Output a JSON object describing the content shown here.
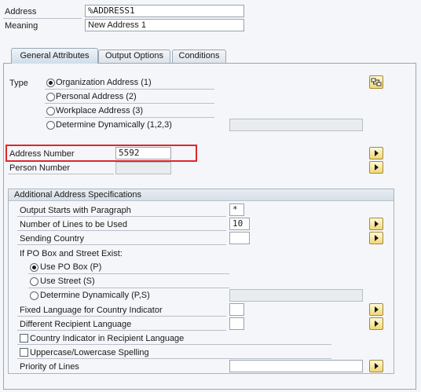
{
  "header": {
    "address_label": "Address",
    "address_value": "%ADDRESS1",
    "meaning_label": "Meaning",
    "meaning_value": "New Address 1"
  },
  "tabs": [
    {
      "label": "General Attributes",
      "active": true
    },
    {
      "label": "Output Options",
      "active": false
    },
    {
      "label": "Conditions",
      "active": false
    }
  ],
  "type_section": {
    "label": "Type",
    "options": [
      {
        "label": "Organization Address (1)",
        "selected": true
      },
      {
        "label": "Personal Address (2)",
        "selected": false
      },
      {
        "label": "Workplace Address (3)",
        "selected": false
      },
      {
        "label": "Determine Dynamically (1,2,3)",
        "selected": false
      }
    ],
    "dynamic_value": "",
    "icon": "address-type-icon"
  },
  "address_number": {
    "label": "Address Number",
    "value": "5592",
    "highlight_color": "#e0262b"
  },
  "person_number": {
    "label": "Person Number",
    "value": ""
  },
  "additional": {
    "title": "Additional Address Specifications",
    "output_starts_label": "Output Starts with Paragraph",
    "output_starts_value": "*",
    "lines_label": "Number of Lines to be Used",
    "lines_value": "10",
    "sending_country_label": "Sending Country",
    "sending_country_value": "",
    "po_box_heading": "If PO Box and Street Exist:",
    "po_options": [
      {
        "label": "Use PO Box (P)",
        "selected": true
      },
      {
        "label": "Use Street (S)",
        "selected": false
      },
      {
        "label": "Determine Dynamically (P,S)",
        "selected": false
      }
    ],
    "po_dynamic_value": "",
    "fixed_language_label": "Fixed Language for Country Indicator",
    "fixed_language_value": "",
    "diff_recipient_label": "Different Recipient Language",
    "diff_recipient_value": "",
    "country_indicator_label": "Country Indicator in Recipient Language",
    "country_indicator_checked": false,
    "uppercase_label": "Uppercase/Lowercase Spelling",
    "uppercase_checked": false,
    "priority_label": "Priority of Lines",
    "priority_value": ""
  }
}
